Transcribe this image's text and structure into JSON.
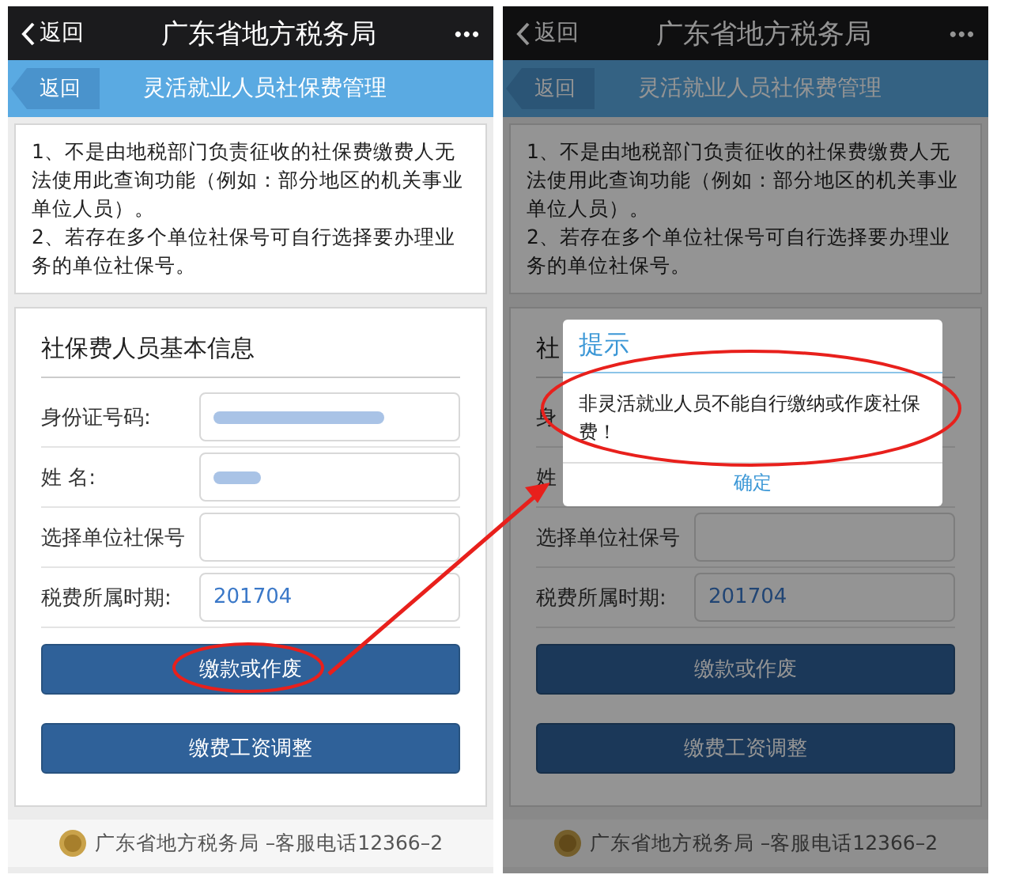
{
  "panels": [
    {
      "nav": {
        "back": "返回",
        "title": "广东省地方税务局",
        "more": "•••"
      },
      "header": {
        "back": "返回",
        "title": "灵活就业人员社保费管理"
      },
      "notice": [
        "1、不是由地税部门负责征收的社保费缴费人无法使用此查询功能（例如：部分地区的机关事业单位人员）。",
        "2、若存在多个单位社保号可自行选择要办理业务的单位社保号。"
      ],
      "form": {
        "title": "社保费人员基本信息",
        "fields": [
          {
            "label": "身份证号码:",
            "redacted": true
          },
          {
            "label": "姓 名:",
            "redacted": true
          },
          {
            "label": "选择单位社保号"
          },
          {
            "label": "税费所属时期:",
            "value": "201704"
          }
        ]
      },
      "buttons": [
        "缴款或作废",
        "缴费工资调整"
      ],
      "footer": "广东省地方税务局 –客服电话12366–2"
    },
    {
      "nav": {
        "back": "返回",
        "title": "广东省地方税务局",
        "more": "•••"
      },
      "header": {
        "back": "返回",
        "title": "灵活就业人员社保费管理"
      },
      "notice": [
        "1、不是由地税部门负责征收的社保费缴费人无法使用此查询功能（例如：部分地区的机关事业单位人员）。",
        "2、若存在多个单位社保号可自行选择要办理业务的单位社保号。"
      ],
      "form": {
        "title": "社",
        "fields": [
          {
            "label": "身",
            "covered": true
          },
          {
            "label": "姓",
            "covered": true
          },
          {
            "label": "选择单位社保号"
          },
          {
            "label": "税费所属时期:",
            "value": "201704"
          }
        ]
      },
      "buttons": [
        "缴款或作废",
        "缴费工资调整"
      ],
      "footer": "广东省地方税务局 –客服电话12366–2",
      "dialog": {
        "title": "提示",
        "message": "非灵活就业人员不能自行缴纳或作废社保费！",
        "button": "确定"
      }
    }
  ]
}
